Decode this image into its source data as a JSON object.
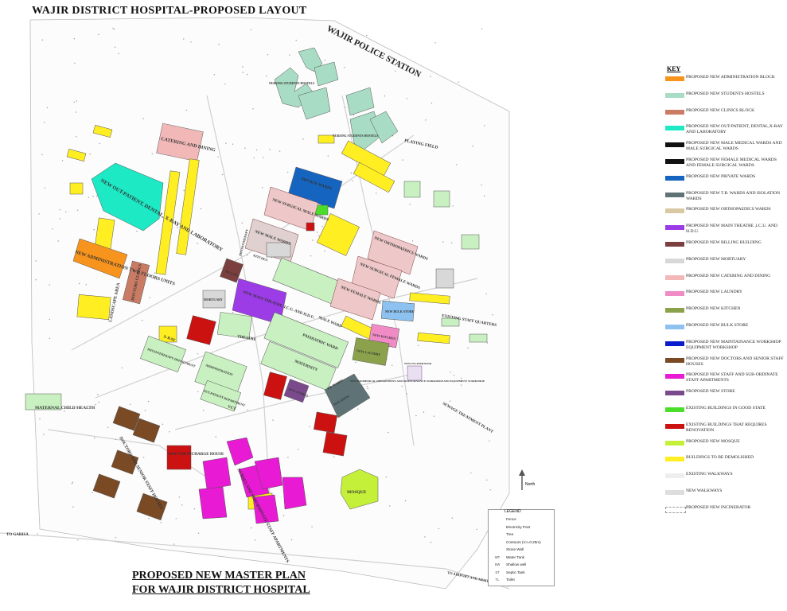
{
  "title": "WAJIR DISTRICT HOSPITAL-PROPOSED LAYOUT",
  "plan_title": [
    "PROPOSED  NEW MASTER PLAN",
    "FOR WAJIR DISTRICT HOSPITAL"
  ],
  "place_labels": {
    "police_station": "WAJIR POLICE STATION",
    "playing_field": "PLAYING FIELD",
    "to_garisa": "TO GARISA",
    "to_airport": "TO AIRPORT  AND  ARMY BARRACKS",
    "north": "North"
  },
  "buildings": {
    "catering": "CATERING AND DINING",
    "outpatient": "NEW OUT-PATIENT, DENTAL, X-RAY AND LABORATORY",
    "administration": "NEW ADMINISTRATION TWO FLOORS UNITS",
    "doctors_clinics": "DOCTORS CLINICS",
    "landscape": "LANDSCAPE AREA",
    "private_wards": "PRIVATE WARDS",
    "surgical_male": "NEW SURGICAL MALE WARDS",
    "male_wards": "NEW MALE WARDS",
    "physiotherapy": "PHYSIOTHERAPY",
    "kitchen": "KITCHEN",
    "billing": "BILLING",
    "theatre_icu": "NEW MAIN THEATRE, I.C.U. AND H.D.U.",
    "mortuary": "MORTUARY",
    "theatre": "THEATRE",
    "xray": "X-RAY",
    "male_ward": "MALE WARD",
    "pediatric": "PAEDIATRIC WARD",
    "maternity": "MATERNITY",
    "orthopaedics": "NEW ORTHOPAEDICS WARDS",
    "surgical_female": "NEW SURGICAL FEMALE WARDS",
    "female_wards": "NEW FEMALE WARDS",
    "bulk_store": "NEW BULK STORE",
    "new_kitchen": "NEW KITCHEN",
    "new_laundry": "NEW LAUNDRY",
    "staff_quarters": "EXISTING STAFF QUARTERS",
    "incinerator": "NEW INCINERATOR",
    "maintenance": "NEW BIOMEDICAL DEPARTMENT AND MAINTAINANCE WORKSHOP AND EQUIPMENT WORKSHOP",
    "sewage": "SEWAGE TREATMENT PLANT",
    "maternal": "MATERNAL CHILD HEALTH",
    "doctors_houses": "DOCTORS AND SENIOR STAFF HOUSES",
    "doctor_incharge": "DOCTOR INCHARGE HOUSE",
    "nurses_apartments": "NURSES AND SUBORDINATE STAFF APARTMENTS",
    "mosque": "MOSQUE",
    "nursing_hostels_1": "NURSING STUDENTS HOSTELS",
    "nursing_hostels_2": "NURSING STUDENTS HOSTELS",
    "new_stores": "NEW STORES",
    "vct": "VCT",
    "physical_therapy": "PHYSIOTHERAPY DEPARTMENT",
    "administration_old": "ADMINISTRATION",
    "outpatient_old": "OUT-PATIENT DEPARTMENT",
    "tb_wards": "T.B. WARDS",
    "isolation": "ISOLATION"
  },
  "key": {
    "title": "KEY",
    "items": [
      {
        "label": "PROPOSED NEW ADMINISTRATION BLOCK",
        "color": "#f7941d"
      },
      {
        "label": "PROPOSED NEW STUDENTS HOSTELS",
        "color": "#a8dcc4"
      },
      {
        "label": "PROPOSED NEW CLINICS BLOCK",
        "color": "#c97b63"
      },
      {
        "label": "PROPOSED NEW OUT-PATIENT, DENTAL,X-RAY AND LABORATORY",
        "color": "#1de9c5"
      },
      {
        "label": "PROPOSED NEW MALE MEDICAL WARDS AND MALE SURGICAL WARDS",
        "color": "#111111"
      },
      {
        "label": "PROPOSED NEW FEMALE MEDICAL WARDS AND FEMALE SURGICAL WARDS",
        "color": "#111111"
      },
      {
        "label": "PROPOSED NEW PRIVATE  WARDS",
        "color": "#1565c0"
      },
      {
        "label": "PROPOSED NEW T.B. WARDS AND ISOLATION WARDS",
        "color": "#5f7376"
      },
      {
        "label": "PROPOSED NEW ORTHOPAEDICS WARDS",
        "color": "#d9c9a3"
      },
      {
        "label": "PROPOSED NEW MAIN THEATRE ,I.C.U. AND H.D.U.",
        "color": "#9c3ce6"
      },
      {
        "label": "PROPOSED NEW BILLING BUILDING",
        "color": "#7b3f3f"
      },
      {
        "label": "PROPOSED NEW MORTUARY",
        "color": "#d8d8d8"
      },
      {
        "label": "PROPOSED NEW CATERING AND DINING",
        "color": "#f2b8b8"
      },
      {
        "label": "PROPOSED NEW LAUNDRY",
        "color": "#f08bc6"
      },
      {
        "label": "PROPOSED NEW KITCHEN",
        "color": "#8ca14b"
      },
      {
        "label": "PROPOSED NEW BULK STORE",
        "color": "#8dc1f0"
      },
      {
        "label": "PROPOSED NEW MAINTAINANCE WORKSHOP EQUIPMENT WORKSHOP",
        "color": "#0a1ccc"
      },
      {
        "label": "PROPOSED NEW DOCTORS AND SENIOR STAFF HOUSES",
        "color": "#7a4a24"
      },
      {
        "label": "PROPOSED NEW STAFF AND SUB-ORDINATE STAFF APARTMENTS",
        "color": "#e81ad4"
      },
      {
        "label": "PROPOSED NEW  STORE",
        "color": "#7b4a8c"
      },
      {
        "label": "EXISTING BUILDINGS IN GOOD STATE",
        "color": "#4ade2a"
      },
      {
        "label": "EXISTING BUILDINGS THAT REQUIRES  RENOVATION",
        "color": "#cc1111"
      },
      {
        "label": "PROPOSED NEW MOSQUE",
        "color": "#c5f03a"
      },
      {
        "label": "BUILDINGS TO BE DEMOLISHED",
        "color": "#ffee22"
      },
      {
        "label": "EXISTING WALKWAYS",
        "color": "#eeeeee"
      },
      {
        "label": "NEW  WALKWAYS",
        "color": "#dddddd"
      },
      {
        "label": "PROPOSED NEW INCINERATOR",
        "color": "#ffffff"
      }
    ]
  },
  "legend": {
    "title": "LEGEND",
    "items": [
      {
        "sym": "",
        "label": "Fence"
      },
      {
        "sym": "",
        "label": "Electricity Post"
      },
      {
        "sym": "",
        "label": "Tree"
      },
      {
        "sym": "",
        "label": "Contours (V.I=0.25m)"
      },
      {
        "sym": "",
        "label": "Stone Wall"
      },
      {
        "sym": "WT",
        "label": "Water Tank"
      },
      {
        "sym": "SW",
        "label": "Shallow well"
      },
      {
        "sym": "ST",
        "label": "Septic Tank"
      },
      {
        "sym": "TL",
        "label": "Toilet"
      }
    ]
  }
}
